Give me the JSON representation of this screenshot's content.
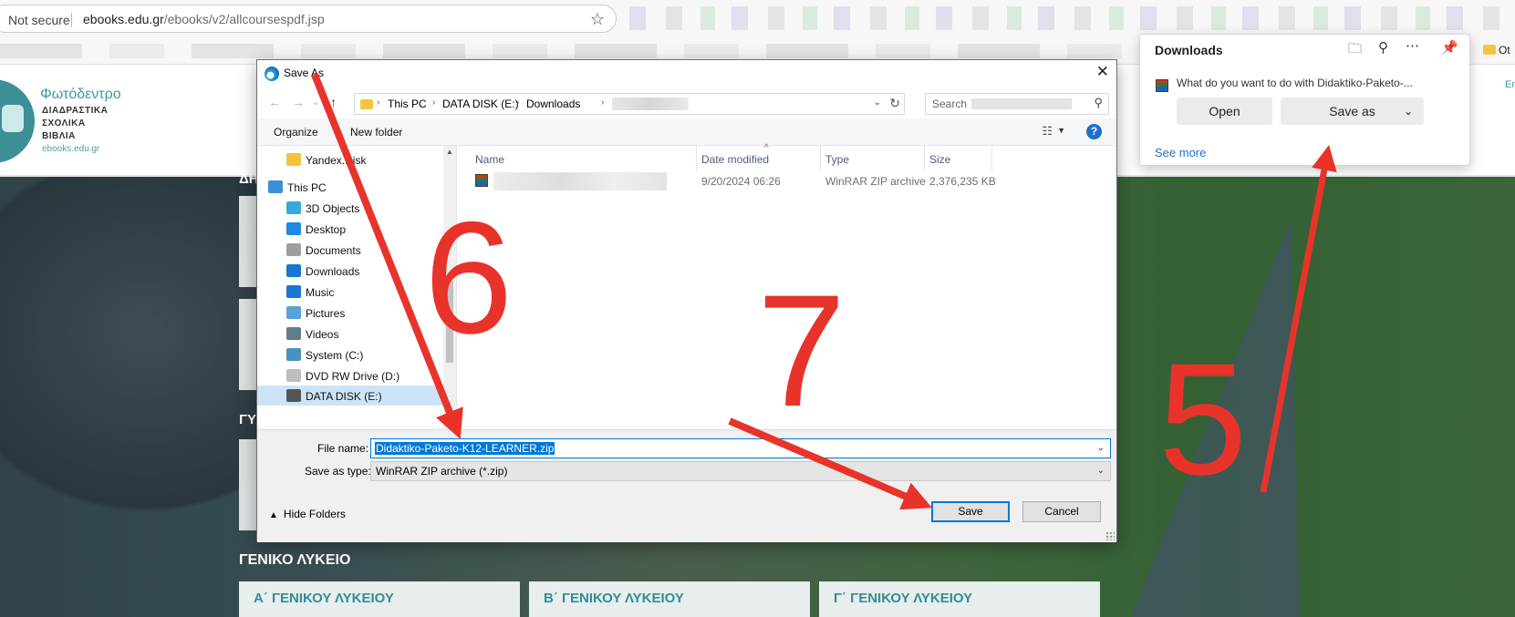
{
  "browser": {
    "not_secure": "Not secure",
    "url_domain": "ebooks.edu.gr",
    "url_path": "/ebooks/v2/allcoursespdf.jsp",
    "bookmark_other": "Ot"
  },
  "site": {
    "brand": "Φωτόδεντρο",
    "tagline": [
      "ΔΙΑΔΡΑΣΤΙΚΑ",
      "ΣΧΟΛΙΚΑ",
      "ΒΙΒΛΙΑ"
    ],
    "domain": "ebooks.edu.gr",
    "side_link": "En",
    "section_partial_1": "ΔΗ",
    "section_partial_2": "ΓΥ",
    "section_title": "ΓΕΝΙΚΟ ΛΥΚΕΙΟ",
    "cards": [
      "Α΄ ΓΕΝΙΚΟΥ ΛΥΚΕΙΟΥ",
      "Β΄ ΓΕΝΙΚΟΥ ΛΥΚΕΙΟΥ",
      "Γ΄ ΓΕΝΙΚΟΥ ΛΥΚΕΙΟΥ"
    ]
  },
  "dialog": {
    "title": "Save As",
    "breadcrumb": [
      "This PC",
      "DATA DISK (E:)",
      "Downloads"
    ],
    "search_placeholder": "Search",
    "organize": "Organize",
    "new_folder": "New folder",
    "help": "?",
    "nav_items": [
      {
        "label": "Yandex.Disk",
        "icon": "yandex-disk-icon",
        "color": "#f4c23b"
      },
      {
        "label": "This PC",
        "icon": "computer-icon",
        "color": "#3b8fd8"
      },
      {
        "label": "3D Objects",
        "icon": "cube-icon",
        "color": "#39a9d9"
      },
      {
        "label": "Desktop",
        "icon": "desktop-icon",
        "color": "#1e88e5"
      },
      {
        "label": "Documents",
        "icon": "document-icon",
        "color": "#9e9e9e"
      },
      {
        "label": "Downloads",
        "icon": "download-icon",
        "color": "#1976d2"
      },
      {
        "label": "Music",
        "icon": "music-note-icon",
        "color": "#1976d2"
      },
      {
        "label": "Pictures",
        "icon": "picture-icon",
        "color": "#5aa0d8"
      },
      {
        "label": "Videos",
        "icon": "video-icon",
        "color": "#607d8b"
      },
      {
        "label": "System (C:)",
        "icon": "drive-icon",
        "color": "#4a90c4"
      },
      {
        "label": "DVD RW Drive (D:)",
        "icon": "disc-icon",
        "color": "#bdbdbd"
      },
      {
        "label": "DATA DISK (E:)",
        "icon": "drive-icon",
        "color": "#555555"
      }
    ],
    "columns": [
      "Name",
      "Date modified",
      "Type",
      "Size"
    ],
    "file": {
      "date": "9/20/2024 06:26",
      "type": "WinRAR ZIP archive",
      "size": "2,376,235 KB"
    },
    "file_name_label": "File name:",
    "file_name": "Didaktiko-Paketo-K12-LEARNER.zip",
    "save_type_label": "Save as type:",
    "save_type": "WinRAR ZIP archive (*.zip)",
    "hide_folders": "Hide Folders",
    "save": "Save",
    "cancel": "Cancel"
  },
  "downloads": {
    "title": "Downloads",
    "question": "What do you want to do with Didaktiko-Paketo-...",
    "open": "Open",
    "save_as": "Save as",
    "see_more": "See more"
  },
  "annotations": [
    "5",
    "6",
    "7"
  ],
  "colors": {
    "annotation_red": "#e8332b",
    "accent_blue": "#0078d7",
    "brand_teal": "#3a9aa3"
  }
}
